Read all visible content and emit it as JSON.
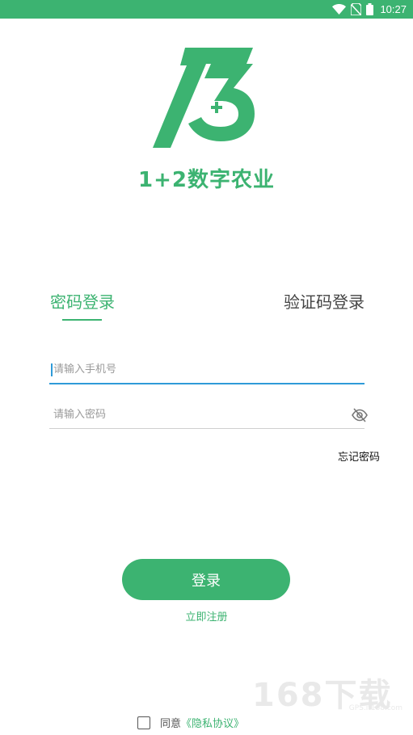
{
  "status_bar": {
    "time": "10:27",
    "icons": [
      "wifi-icon",
      "sim-no-signal-icon",
      "battery-icon"
    ],
    "color": "#3cb371"
  },
  "app": {
    "title": "1+2数字农业",
    "logo_icon": "app-logo-icon",
    "brand_color": "#3cb371"
  },
  "tabs": [
    {
      "label": "密码登录",
      "active": true
    },
    {
      "label": "验证码登录",
      "active": false
    }
  ],
  "form": {
    "phone_placeholder": "请输入手机号",
    "phone_value": "",
    "password_placeholder": "请输入密码",
    "password_value": "",
    "visibility_icon": "eye-off-icon",
    "forgot_label": "忘记密码"
  },
  "actions": {
    "login_label": "登录",
    "register_label": "立即注册"
  },
  "agreement": {
    "checked": false,
    "text": "同意",
    "link_label": "《隐私协议》"
  },
  "watermark": {
    "main": "168下载",
    "sub": "GPS.it168.com"
  }
}
